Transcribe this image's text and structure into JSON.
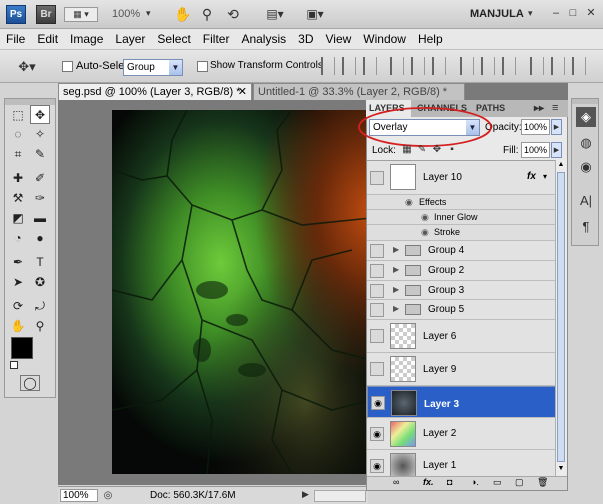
{
  "appbar": {
    "logo_ps": "Ps",
    "logo_br": "Br",
    "zoom": "100%",
    "workspace": "MANJULA"
  },
  "menu": [
    "File",
    "Edit",
    "Image",
    "Layer",
    "Select",
    "Filter",
    "Analysis",
    "3D",
    "View",
    "Window",
    "Help"
  ],
  "options": {
    "auto_select_label": "Auto-Select:",
    "auto_select_value": "Group",
    "show_transform_label": "Show Transform Controls"
  },
  "tabs": [
    {
      "label": "seg.psd @ 100% (Layer 3, RGB/8) *"
    },
    {
      "label": "Untitled-1 @ 33.3% (Layer 2, RGB/8) *"
    }
  ],
  "status": {
    "zoom": "100%",
    "doc": "Doc: 560.3K/17.6M"
  },
  "layers_panel": {
    "tabs": [
      "LAYERS",
      "CHANNELS",
      "PATHS"
    ],
    "blend_mode": "Overlay",
    "opacity_label": "Opacity:",
    "opacity_value": "100%",
    "lock_label": "Lock:",
    "fill_label": "Fill:",
    "fill_value": "100%",
    "layer10": "Layer 10",
    "fx": "fx",
    "effects": "Effects",
    "inner_glow": "Inner Glow",
    "stroke": "Stroke",
    "groups": [
      "Group 4",
      "Group 2",
      "Group 3",
      "Group 5"
    ],
    "layer6": "Layer 6",
    "layer9": "Layer 9",
    "layer3": "Layer 3",
    "layer2": "Layer 2",
    "layer1": "Layer 1"
  },
  "colors": {
    "selection": "#2a5fc8",
    "highlight_ellipse": "#d42020"
  }
}
